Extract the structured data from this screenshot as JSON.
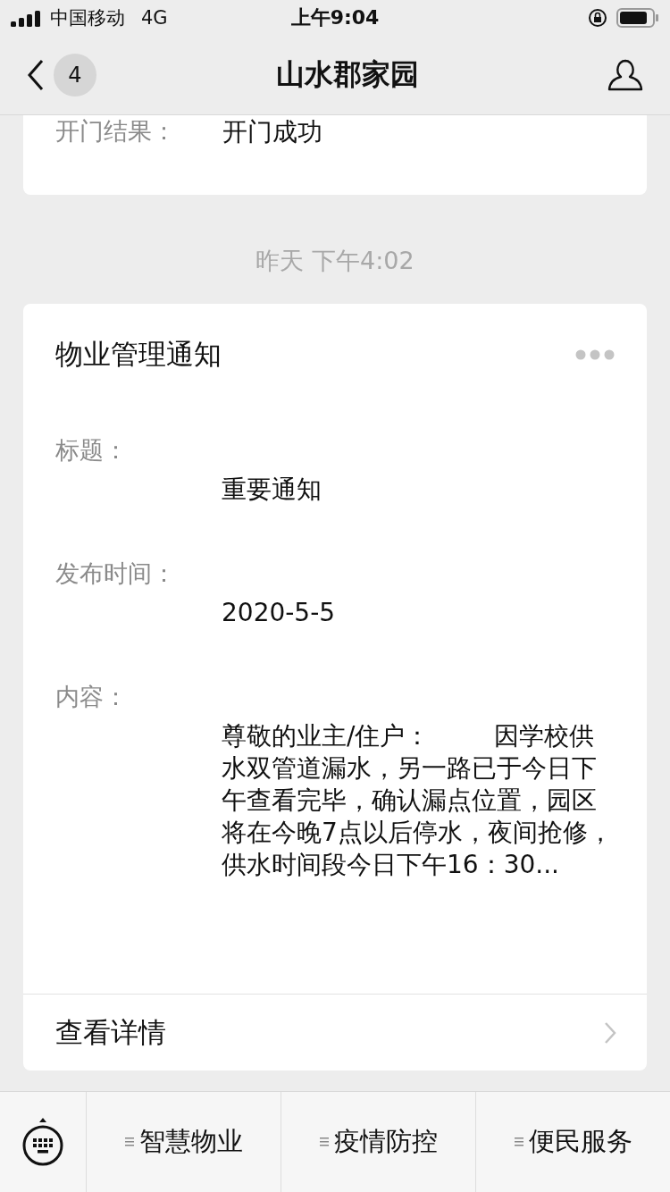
{
  "status_bar": {
    "carrier": "中国移动",
    "network": "4G",
    "time": "上午9:04"
  },
  "nav": {
    "title": "山水郡家园",
    "unread": "4"
  },
  "prev_card": {
    "label": "开门结果：",
    "value": "开门成功"
  },
  "timestamp": "昨天 下午4:02",
  "card": {
    "title": "物业管理通知",
    "fields": [
      {
        "label": "标题：",
        "value": "重要通知"
      },
      {
        "label": "发布时间：",
        "value": "2020-5-5"
      },
      {
        "label": "内容：",
        "value": "尊敬的业主/住户：        因学校供水双管道漏水，另一路已于今日下午查看完毕，确认漏点位置，园区将在今晚7点以后停水，夜间抢修，供水时间段今日下午16：30..."
      }
    ],
    "link": "查看详情"
  },
  "menu": [
    "智慧物业",
    "疫情防控",
    "便民服务"
  ]
}
